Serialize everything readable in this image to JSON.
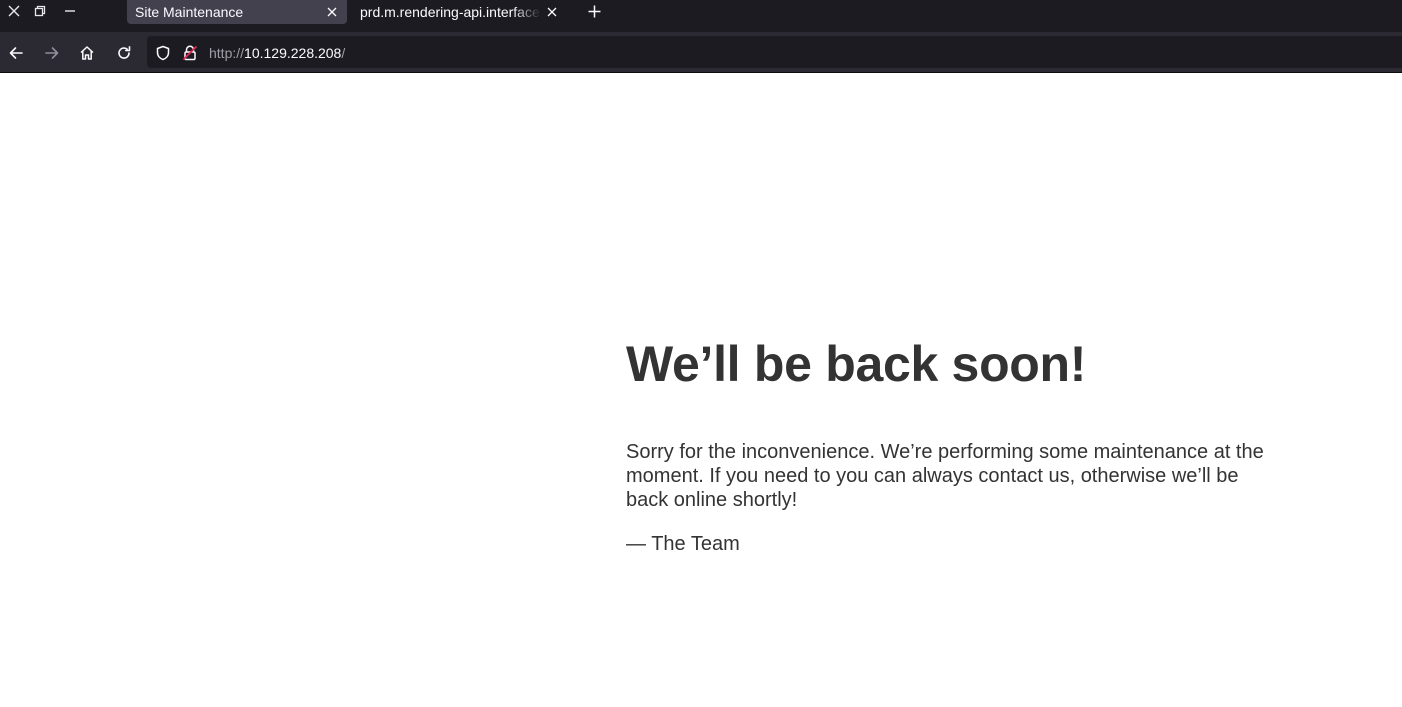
{
  "browser": {
    "tabs": [
      {
        "title": "Site Maintenance",
        "active": true
      },
      {
        "title": "prd.m.rendering-api.interface.htb",
        "active": false
      }
    ],
    "url": {
      "scheme": "http://",
      "host": "10.129.228.208",
      "path": "/"
    },
    "icons": {
      "close_window": "close-icon",
      "restore_window": "restore-icon",
      "minimize_window": "minimize-icon",
      "back": "arrow-left-icon",
      "forward": "arrow-right-icon",
      "home": "home-icon",
      "reload": "reload-icon",
      "tracking_protection": "shield-icon",
      "insecure_connection": "lock-insecure-icon",
      "new_tab": "plus-icon"
    }
  },
  "page": {
    "heading": "We’ll be back soon!",
    "message": "Sorry for the inconvenience. We’re performing some maintenance at the moment. If you need to you can always contact us, otherwise we’ll be back online shortly!",
    "signature": "— The Team"
  },
  "colors": {
    "tabstrip_bg": "#1c1b22",
    "active_tab_bg": "#42414d",
    "navbar_bg": "#2b2a33",
    "urlbar_bg": "#1c1b22",
    "insecure_lock": "#e22850",
    "page_text": "#333333",
    "page_bg": "#ffffff"
  }
}
